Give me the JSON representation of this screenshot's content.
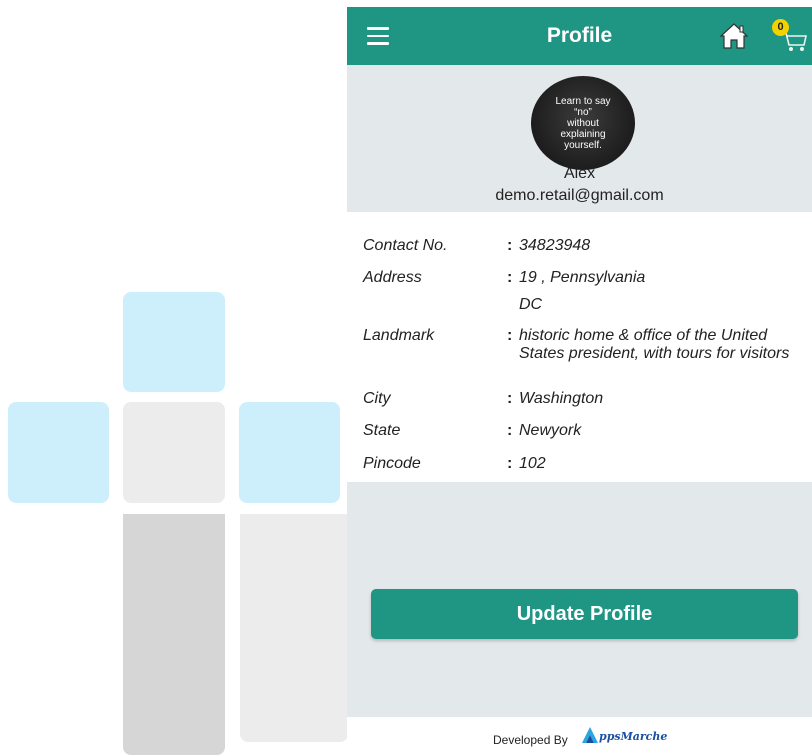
{
  "appbar": {
    "title": "Profile",
    "cart_count": "0"
  },
  "profile": {
    "avatar_text": [
      "Learn to say",
      "“no”",
      "without",
      "explaining",
      "yourself."
    ],
    "name": "Alex",
    "email": "demo.retail@gmail.com"
  },
  "details": [
    {
      "label": "Contact No.",
      "value": "34823948"
    },
    {
      "label": "Address",
      "value": "19 ,  Pennsylvania",
      "value2": "DC"
    },
    {
      "label": "Landmark",
      "value": "historic home & office of the United States president, with tours for visitors"
    },
    {
      "label": "City",
      "value": "Washington"
    },
    {
      "label": "State",
      "value": "Newyork"
    },
    {
      "label": "Pincode",
      "value": "102"
    }
  ],
  "update_button": "Update Profile",
  "footer": {
    "developed_by": "Developed By",
    "brand": "ppsMarche"
  },
  "colors": {
    "primary": "#1e9683",
    "badge": "#f4d100",
    "tile_blue": "#cdeffc"
  },
  "icons": [
    "menu-icon",
    "home-icon",
    "cart-icon"
  ]
}
